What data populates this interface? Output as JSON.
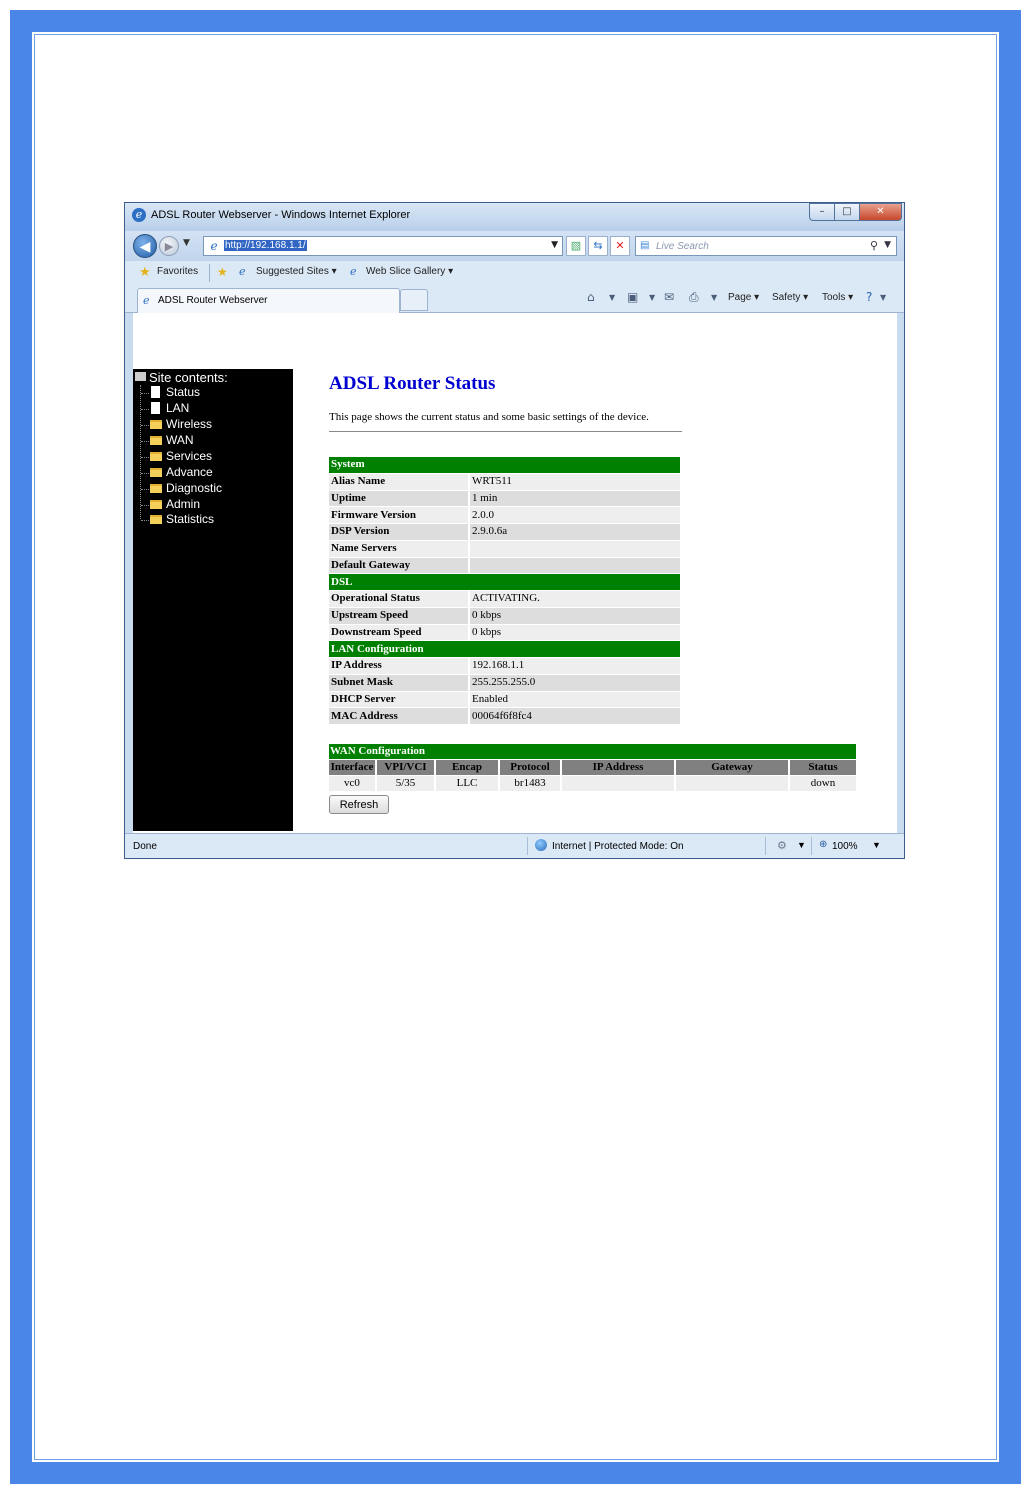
{
  "window": {
    "title": "ADSL Router Webserver - Windows Internet Explorer",
    "min_glyph": "–",
    "max_glyph": "□",
    "close_glyph": "✕"
  },
  "address_bar": {
    "url": "http://192.168.1.1/",
    "search_placeholder": "Live Search"
  },
  "favorites_bar": {
    "favorites_label": "Favorites",
    "suggested_sites_label": "Suggested Sites ▾",
    "web_slice_gallery_label": "Web Slice Gallery ▾"
  },
  "tab": {
    "label": "ADSL Router Webserver"
  },
  "command_bar": {
    "page_label": "Page ▾",
    "safety_label": "Safety ▾",
    "tools_label": "Tools ▾"
  },
  "sidebar": {
    "header": "Site contents:",
    "items": [
      {
        "label": "Status",
        "icon": "document-icon"
      },
      {
        "label": "LAN",
        "icon": "document-icon"
      },
      {
        "label": "Wireless",
        "icon": "folder-icon"
      },
      {
        "label": "WAN",
        "icon": "folder-icon"
      },
      {
        "label": "Services",
        "icon": "folder-icon"
      },
      {
        "label": "Advance",
        "icon": "folder-icon"
      },
      {
        "label": "Diagnostic",
        "icon": "folder-icon"
      },
      {
        "label": "Admin",
        "icon": "folder-icon"
      },
      {
        "label": "Statistics",
        "icon": "folder-icon"
      }
    ]
  },
  "main": {
    "title": "ADSL Router Status",
    "description": "This page shows the current status and some basic settings of the device.",
    "system": {
      "section": "System",
      "rows": [
        {
          "key": "Alias Name",
          "value": "WRT511"
        },
        {
          "key": "Uptime",
          "value": "1 min"
        },
        {
          "key": "Firmware Version",
          "value": "2.0.0"
        },
        {
          "key": "DSP Version",
          "value": "2.9.0.6a"
        },
        {
          "key": "Name Servers",
          "value": ""
        },
        {
          "key": "Default Gateway",
          "value": ""
        }
      ]
    },
    "dsl": {
      "section": "DSL",
      "rows": [
        {
          "key": "Operational Status",
          "value": "ACTIVATING."
        },
        {
          "key": "Upstream Speed",
          "value": "0 kbps"
        },
        {
          "key": "Downstream Speed",
          "value": "0 kbps"
        }
      ]
    },
    "lan": {
      "section": "LAN Configuration",
      "rows": [
        {
          "key": "IP Address",
          "value": "192.168.1.1"
        },
        {
          "key": "Subnet Mask",
          "value": "255.255.255.0"
        },
        {
          "key": "DHCP Server",
          "value": "Enabled"
        },
        {
          "key": "MAC Address",
          "value": "00064f6f8fc4"
        }
      ]
    },
    "wan": {
      "section": "WAN Configuration",
      "headers": [
        "Interface",
        "VPI/VCI",
        "Encap",
        "Protocol",
        "IP Address",
        "Gateway",
        "Status"
      ],
      "row": [
        "vc0",
        "5/35",
        "LLC",
        "br1483",
        "",
        "",
        "down"
      ]
    },
    "refresh_label": "Refresh"
  },
  "status_bar": {
    "left": "Done",
    "zone": "Internet | Protected Mode: On",
    "zoom": "100%"
  }
}
